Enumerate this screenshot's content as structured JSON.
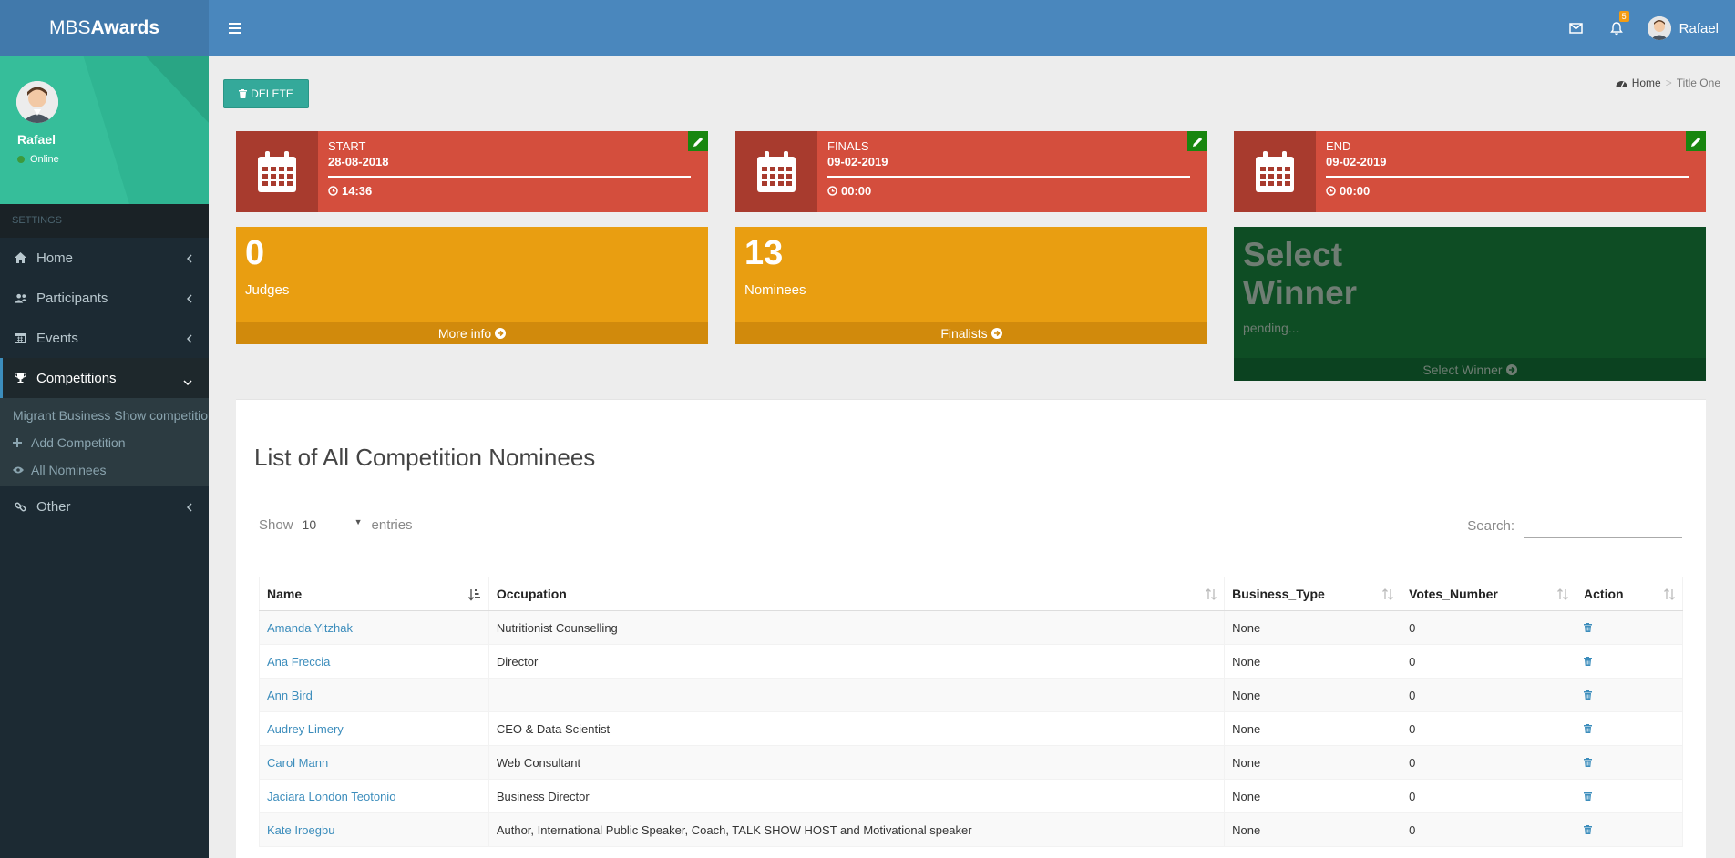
{
  "app": {
    "logo_prefix": "MBS",
    "logo_bold": "Awards",
    "user_name": "Rafael",
    "notification_count": "5"
  },
  "sidebar": {
    "user": {
      "name": "Rafael",
      "status": "Online"
    },
    "section_header": "SETTINGS",
    "items": [
      {
        "label": "Home",
        "icon": "home-icon"
      },
      {
        "label": "Participants",
        "icon": "users-icon"
      },
      {
        "label": "Events",
        "icon": "calendar-icon"
      },
      {
        "label": "Competitions",
        "icon": "trophy-icon"
      },
      {
        "label": "Other",
        "icon": "link-icon"
      }
    ],
    "submenu": [
      {
        "label": "Migrant Business Show competition"
      },
      {
        "label": "Add Competition",
        "icon": "plus-icon"
      },
      {
        "label": "All Nominees",
        "icon": "eye-icon"
      }
    ]
  },
  "toolbar": {
    "delete_label": "DELETE"
  },
  "breadcrumb": {
    "home": "Home",
    "current": "Title One"
  },
  "dates": [
    {
      "label": "START",
      "date": "28-08-2018",
      "time": "14:36"
    },
    {
      "label": "FINALS",
      "date": "09-02-2019",
      "time": "00:00"
    },
    {
      "label": "END",
      "date": "09-02-2019",
      "time": "00:00"
    }
  ],
  "stats": {
    "judges": {
      "value": "0",
      "label": "Judges",
      "footer": "More info"
    },
    "nominees": {
      "value": "13",
      "label": "Nominees",
      "footer": "Finalists"
    },
    "winner": {
      "value": "Select Winner",
      "label": "pending...",
      "footer": "Select Winner"
    }
  },
  "table": {
    "title": "List of All Competition Nominees",
    "show_label": "Show",
    "entries_label": "entries",
    "page_length": "10",
    "search_label": "Search:",
    "columns": [
      "Name",
      "Occupation",
      "Business_Type",
      "Votes_Number",
      "Action"
    ],
    "rows": [
      {
        "name": "Amanda Yitzhak",
        "occupation": "Nutritionist Counselling",
        "business_type": "None",
        "votes": "0"
      },
      {
        "name": "Ana Freccia",
        "occupation": "Director",
        "business_type": "None",
        "votes": "0"
      },
      {
        "name": "Ann Bird",
        "occupation": "",
        "business_type": "None",
        "votes": "0"
      },
      {
        "name": "Audrey Limery",
        "occupation": "CEO & Data Scientist",
        "business_type": "None",
        "votes": "0"
      },
      {
        "name": "Carol Mann",
        "occupation": "Web Consultant",
        "business_type": "None",
        "votes": "0"
      },
      {
        "name": "Jaciara London Teotonio",
        "occupation": "Business Director",
        "business_type": "None",
        "votes": "0"
      },
      {
        "name": "Kate Iroegbu",
        "occupation": "Author, International Public Speaker, Coach, TALK SHOW HOST and Motivational speaker",
        "business_type": "None",
        "votes": "0"
      }
    ]
  },
  "colors": {
    "header": "#4a87bd",
    "sidebar": "#1c2a33",
    "danger": "#d44e3d",
    "warning": "#e99e11",
    "success_dark": "#0e4d24",
    "teal": "#34a99a"
  }
}
